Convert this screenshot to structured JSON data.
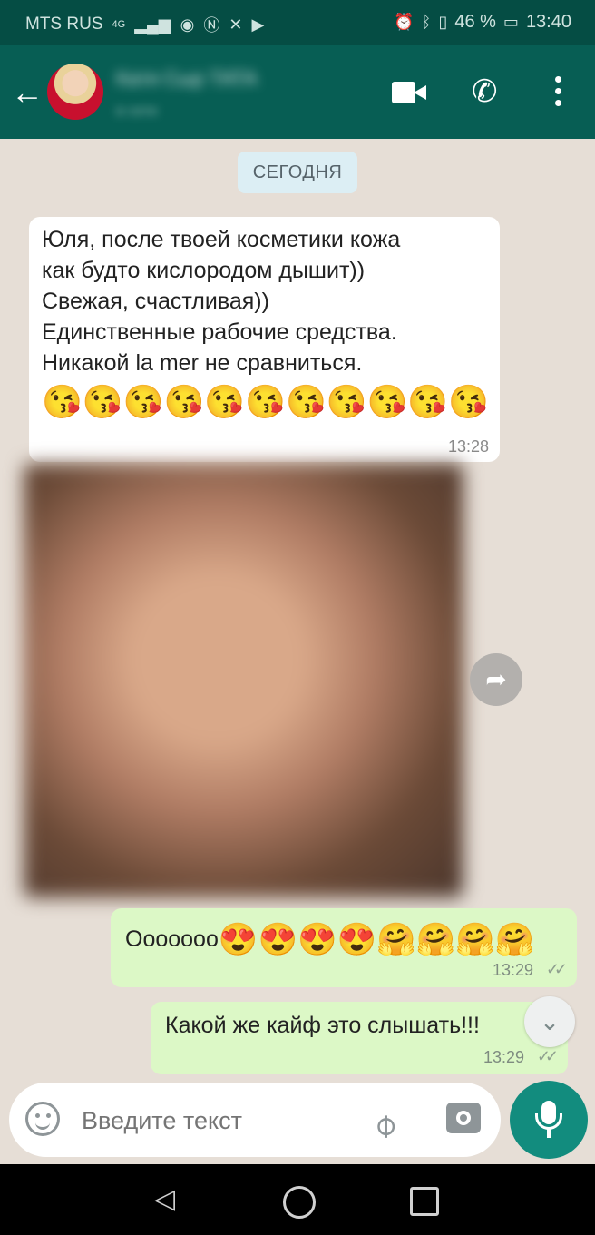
{
  "status_bar": {
    "carrier": "MTS RUS",
    "network": "4G",
    "battery": "46 %",
    "time": "13:40"
  },
  "header": {
    "contact_name": "Катя Сыр ТАТА",
    "contact_status": "в сети"
  },
  "chat": {
    "date_chip": "СЕГОДНЯ",
    "messages": [
      {
        "direction": "in",
        "text": "Юля, после твоей косметики кожа\nкак будто кислородом дышит))\nСвежая, счастливая))\nЕдинственные рабочие средства.\nНикакой la mer не сравниться.",
        "emojis": "😘😘😘😘😘😘😘😘😘😘😘",
        "time": "13:28"
      },
      {
        "direction": "out",
        "text": "Ооооооо",
        "emojis": "😍😍😍😍🤗🤗🤗🤗",
        "time": "13:29",
        "status": "✓✓"
      },
      {
        "direction": "out",
        "text": "Какой же кайф это слышать!!!",
        "time": "13:29",
        "status": "✓✓"
      }
    ]
  },
  "composer": {
    "placeholder": "Введите текст"
  },
  "icons": {
    "back": "←",
    "phone": "✆",
    "forward": "➦",
    "scroll_down": "⌄",
    "attach": "⌀",
    "nav_back": "◁"
  },
  "colors": {
    "header": "#075e54",
    "status_bar": "#054d44",
    "chat_bg": "#e6ded6",
    "incoming_bubble": "#ffffff",
    "outgoing_bubble": "#dcf8c6",
    "accent": "#128c7e"
  }
}
